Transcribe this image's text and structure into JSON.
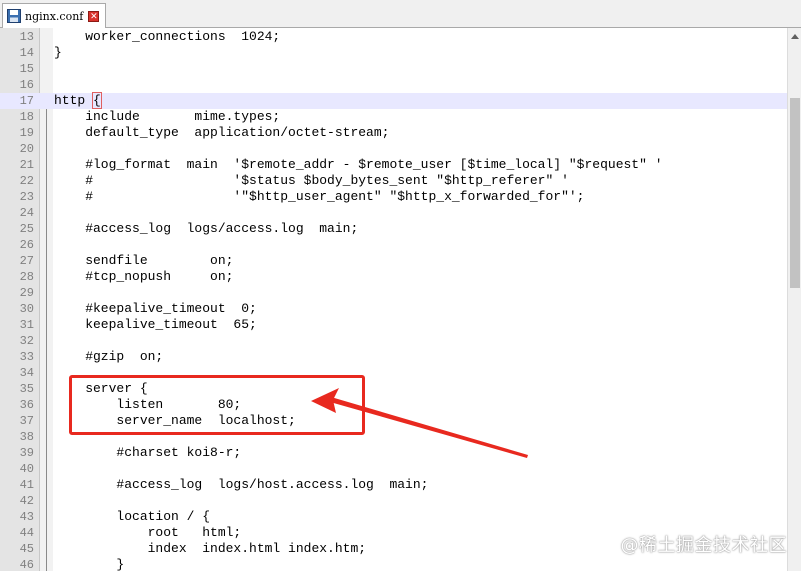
{
  "tab": {
    "label": "nginx.conf",
    "close_icon": "close-x-icon",
    "file_icon": "floppy-disk-icon"
  },
  "lines": [
    {
      "n": "13",
      "code": "    worker_connections  1024;"
    },
    {
      "n": "14",
      "code": "}"
    },
    {
      "n": "15",
      "code": ""
    },
    {
      "n": "16",
      "code": ""
    },
    {
      "n": "17",
      "code": "http {",
      "current": true
    },
    {
      "n": "18",
      "code": "    include       mime.types;"
    },
    {
      "n": "19",
      "code": "    default_type  application/octet-stream;"
    },
    {
      "n": "20",
      "code": ""
    },
    {
      "n": "21",
      "code": "    #log_format  main  '$remote_addr - $remote_user [$time_local] \"$request\" '"
    },
    {
      "n": "22",
      "code": "    #                  '$status $body_bytes_sent \"$http_referer\" '"
    },
    {
      "n": "23",
      "code": "    #                  '\"$http_user_agent\" \"$http_x_forwarded_for\"';"
    },
    {
      "n": "24",
      "code": ""
    },
    {
      "n": "25",
      "code": "    #access_log  logs/access.log  main;"
    },
    {
      "n": "26",
      "code": ""
    },
    {
      "n": "27",
      "code": "    sendfile        on;"
    },
    {
      "n": "28",
      "code": "    #tcp_nopush     on;"
    },
    {
      "n": "29",
      "code": ""
    },
    {
      "n": "30",
      "code": "    #keepalive_timeout  0;"
    },
    {
      "n": "31",
      "code": "    keepalive_timeout  65;"
    },
    {
      "n": "32",
      "code": ""
    },
    {
      "n": "33",
      "code": "    #gzip  on;"
    },
    {
      "n": "34",
      "code": ""
    },
    {
      "n": "35",
      "code": "    server {"
    },
    {
      "n": "36",
      "code": "        listen       80;"
    },
    {
      "n": "37",
      "code": "        server_name  localhost;"
    },
    {
      "n": "38",
      "code": ""
    },
    {
      "n": "39",
      "code": "        #charset koi8-r;"
    },
    {
      "n": "40",
      "code": ""
    },
    {
      "n": "41",
      "code": "        #access_log  logs/host.access.log  main;"
    },
    {
      "n": "42",
      "code": ""
    },
    {
      "n": "43",
      "code": "        location / {"
    },
    {
      "n": "44",
      "code": "            root   html;"
    },
    {
      "n": "45",
      "code": "            index  index.html index.htm;"
    },
    {
      "n": "46",
      "code": "        }"
    }
  ],
  "watermark": "@稀土掘金技术社区",
  "colors": {
    "annotation": "#e8291f",
    "current_line": "#e8e8ff"
  }
}
